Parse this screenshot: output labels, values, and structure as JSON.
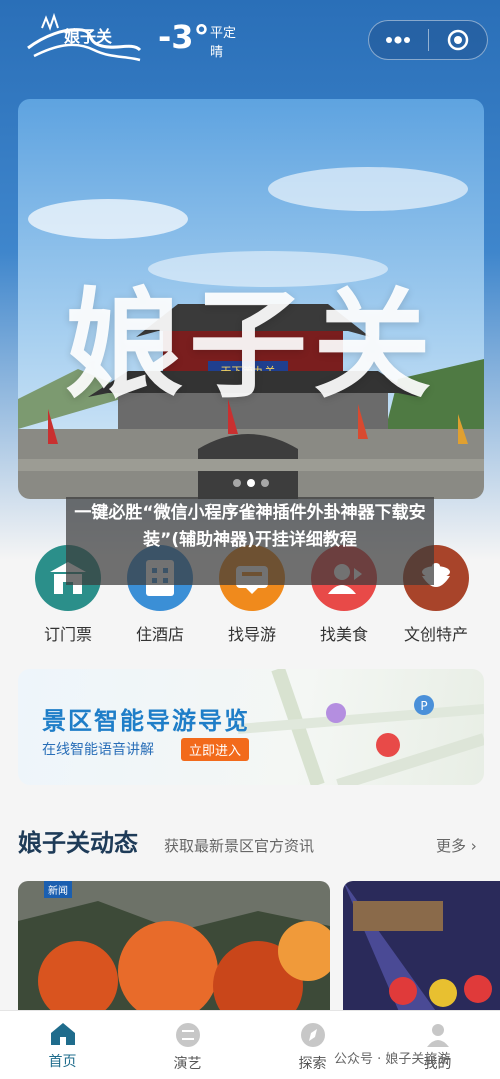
{
  "header": {
    "logo_text": "娘子关",
    "temperature": "-3°",
    "location": "平定",
    "condition": "晴",
    "capsule_more_icon": "more-dots-icon",
    "capsule_close_icon": "target-icon"
  },
  "banner": {
    "title": "娘子关",
    "gate_plaque": "天下第九关",
    "page_count": 3,
    "active_index": 1
  },
  "overlay": {
    "text": "一键必胜“微信小程序雀神插件外卦神器下载安装”(辅助神器)开挂详细教程"
  },
  "menu": {
    "items": [
      {
        "label": "订门票",
        "icon": "ticket-gate-icon",
        "color": "#2b8f8a"
      },
      {
        "label": "住酒店",
        "icon": "hotel-icon",
        "color": "#3b8fd6"
      },
      {
        "label": "找导游",
        "icon": "guide-icon",
        "color": "#f08a1c"
      },
      {
        "label": "找美食",
        "icon": "food-icon",
        "color": "#e84a48"
      },
      {
        "label": "文创特产",
        "icon": "pot-icon",
        "color": "#a8442a"
      }
    ]
  },
  "guide": {
    "title": "景区智能导游导览",
    "subtitle": "在线智能语音讲解",
    "button": "立即进入"
  },
  "news_section": {
    "title": "娘子关动态",
    "subtitle": "获取最新景区官方资讯",
    "more": "更多 ›",
    "tag": "新闻"
  },
  "tabbar": {
    "tabs": [
      {
        "label": "首页",
        "icon": "home-icon",
        "active": true
      },
      {
        "label": "演艺",
        "icon": "performance-icon",
        "active": false
      },
      {
        "label": "探索",
        "icon": "compass-icon",
        "active": false
      },
      {
        "label": "我的",
        "icon": "user-icon",
        "active": false
      }
    ]
  },
  "watermark": "公众号 · 娘子关旅游",
  "colors": {
    "accent": "#1f7ec8",
    "orange": "#f26a1b",
    "tab_active": "#1f6c8c"
  }
}
